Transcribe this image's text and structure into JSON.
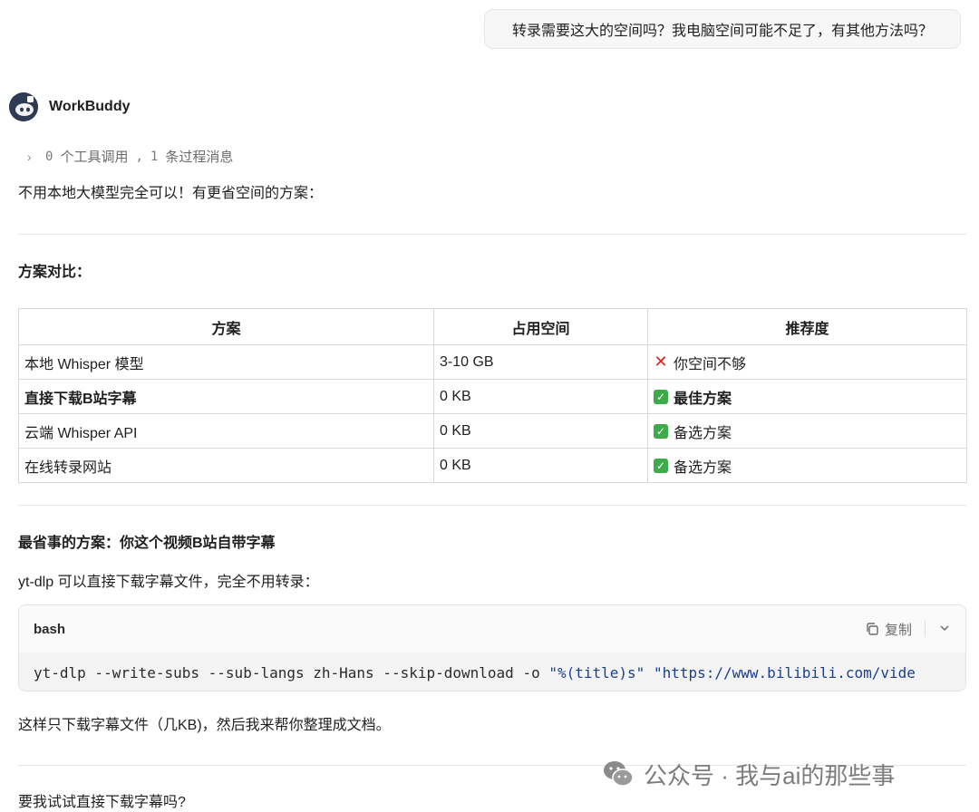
{
  "user_message": "转录需要这大的空间吗？我电脑空间可能不足了，有其他方法吗？",
  "assistant": {
    "name": "WorkBuddy",
    "tool_summary": {
      "tool_count": "0",
      "tool_label": "个工具调用",
      "separator": ",",
      "process_count": "1",
      "process_label": "条过程消息"
    },
    "intro": "不用本地大模型完全可以！有更省空间的方案：",
    "compare_heading": "方案对比：",
    "table": {
      "headers": [
        "方案",
        "占用空间",
        "推荐度"
      ],
      "rows": [
        {
          "name": "本地 Whisper 模型",
          "space": "3-10 GB",
          "rec": "你空间不够",
          "mark": "cross",
          "bold": false
        },
        {
          "name": "直接下载B站字幕",
          "space": "0 KB",
          "rec": "最佳方案",
          "mark": "check",
          "bold": true
        },
        {
          "name": "云端 Whisper API",
          "space": "0 KB",
          "rec": "备选方案",
          "mark": "check",
          "bold": false
        },
        {
          "name": "在线转录网站",
          "space": "0 KB",
          "rec": "备选方案",
          "mark": "check",
          "bold": false
        }
      ]
    },
    "best_heading": "最省事的方案：你这个视频B站自带字幕",
    "best_desc": "yt-dlp 可以直接下载字幕文件，完全不用转录：",
    "code": {
      "lang": "bash",
      "copy_label": "复制",
      "command": "yt-dlp --write-subs --sub-langs zh-Hans --skip-download -o ",
      "arg1": "\"%(title)s\"",
      "arg2": "\"https://www.bilibili.com/vide"
    },
    "after_code": "这样只下载字幕文件（几KB)，然后我来帮你整理成文档。",
    "question": "要我试试直接下载字幕吗?"
  },
  "watermark": "公众号 · 我与ai的那些事",
  "colors": {
    "check": "#3dab49",
    "cross": "#e02020",
    "code_string": "#1a3f8c"
  }
}
